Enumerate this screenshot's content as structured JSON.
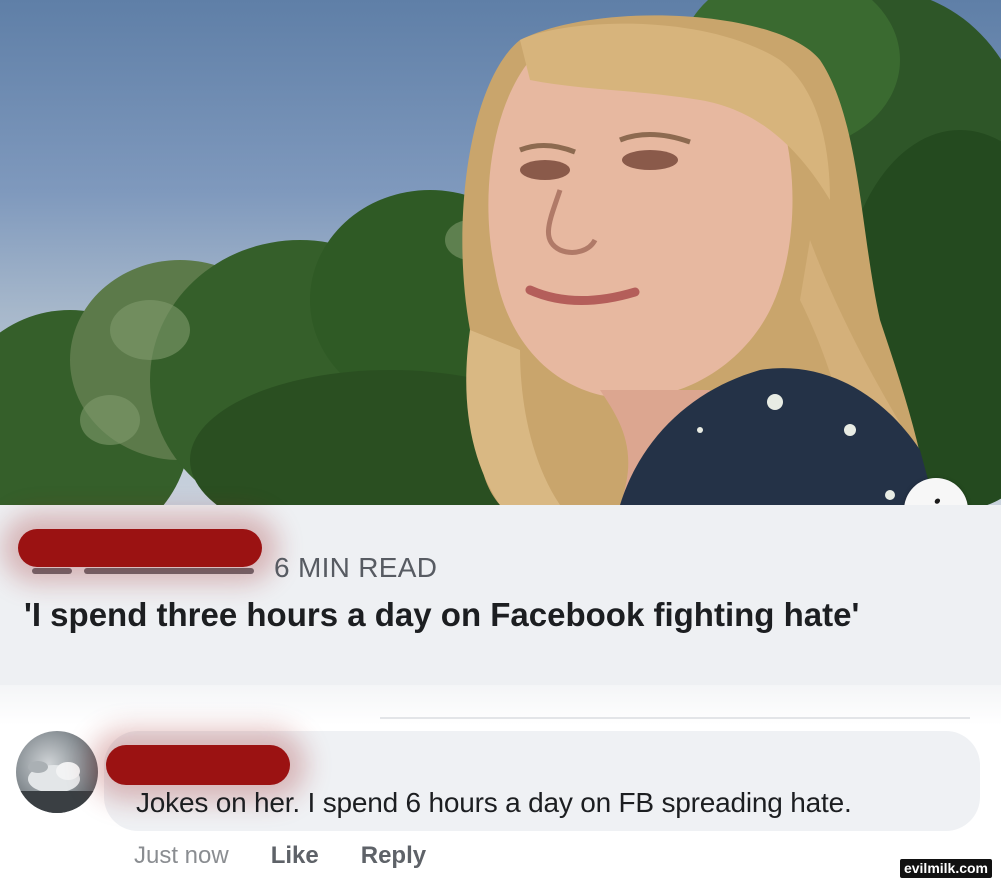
{
  "link_preview": {
    "read_time": "6 MIN READ",
    "headline": "'I spend three hours a day on Facebook fighting hate'",
    "info_icon": "info-icon",
    "info_glyph": "i"
  },
  "comment": {
    "text": "Jokes on her. I spend 6 hours a day on FB spreading hate.",
    "timestamp": "Just now",
    "like_label": "Like",
    "reply_label": "Reply"
  },
  "watermark": {
    "text": "evilmilk.com"
  },
  "colors": {
    "redaction": "#9b1212",
    "card_background": "#eef0f3",
    "bubble_background": "#eff1f4",
    "headline_text": "#1c1e21",
    "secondary_text": "#575b62"
  }
}
